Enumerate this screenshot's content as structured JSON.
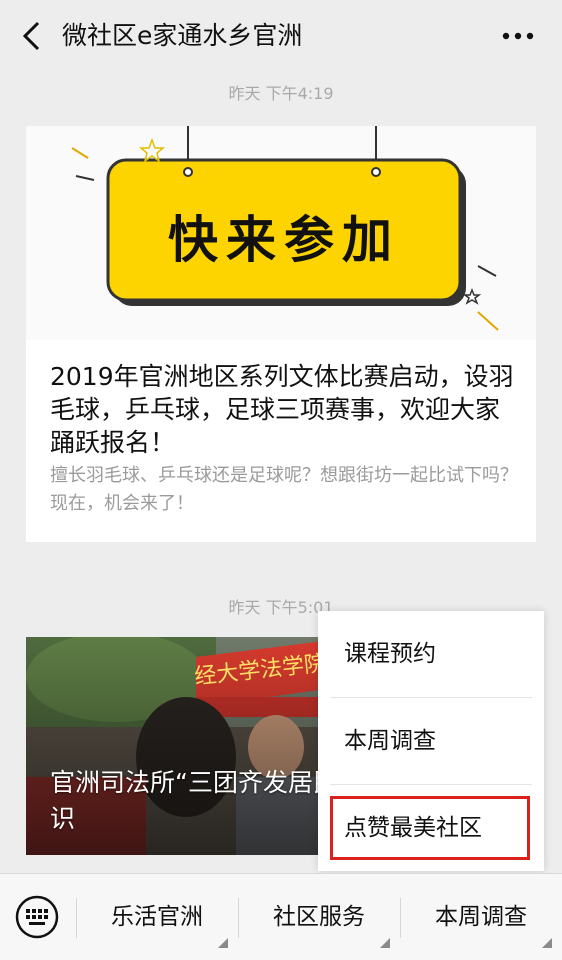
{
  "header": {
    "title": "微社区e家通水乡官洲",
    "back_icon": "chevron-left-icon",
    "more_icon": "more-dots-icon"
  },
  "messages": [
    {
      "time": "昨天 下午4:19",
      "banner_text": "快来参加",
      "title": "2019年官洲地区系列文体比赛启动，设羽毛球，乒乓球，足球三项赛事，欢迎大家踊跃报名！",
      "description": "擅长羽毛球、乒乓球还是足球呢？想跟街坊一起比试下吗？现在，机会来了！"
    },
    {
      "time": "昨天 下午5:01",
      "photo_banner_text": "经大学法学院普",
      "caption": "官洲司法所“三团齐发居民讲解法律知识"
    }
  ],
  "popup_menu": {
    "items": [
      "课程预约",
      "本周调查",
      "点赞最美社区"
    ],
    "highlighted_index": 2,
    "highlight_color": "#d9221d"
  },
  "bottom_menu": {
    "keyboard_icon": "keyboard-icon",
    "items": [
      "乐活官洲",
      "社区服务",
      "本周调查"
    ]
  },
  "colors": {
    "banner_yellow": "#fdd400",
    "background": "#ededed"
  }
}
